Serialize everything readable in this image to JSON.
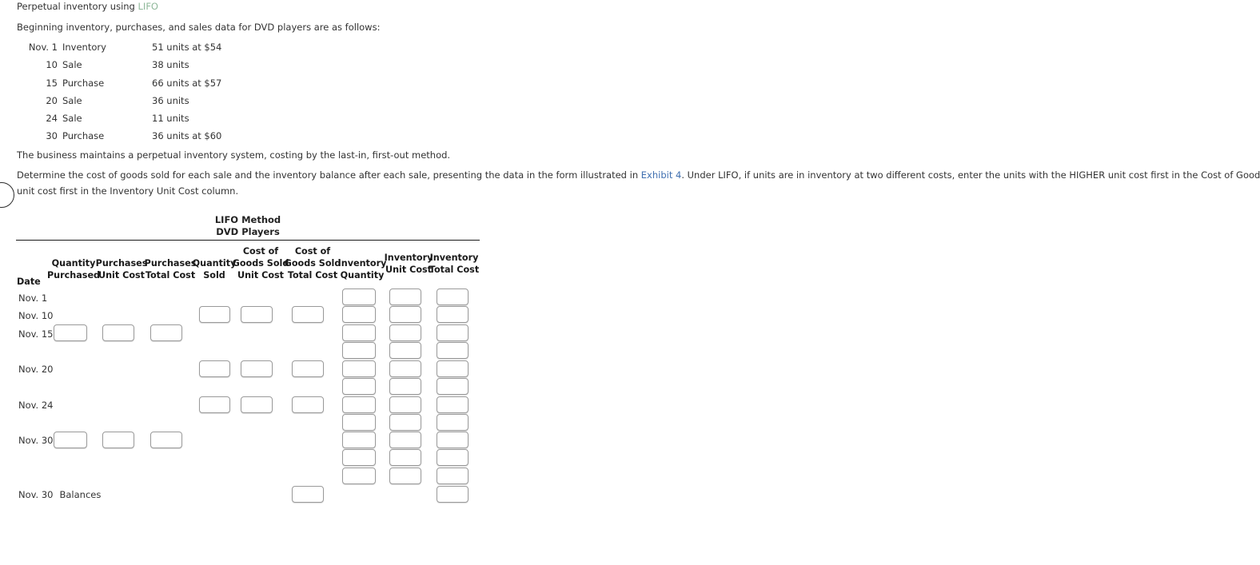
{
  "intro": {
    "title_prefix": "Perpetual inventory using ",
    "title_link": "LIFO",
    "lead": "Beginning inventory, purchases, and sales data for DVD players are as follows:",
    "perpetual_note": "The business maintains a perpetual inventory system, costing by the last-in, first-out method.",
    "determine_part1": "Determine the cost of goods sold for each sale and the inventory balance after each sale, presenting the data in the form illustrated in ",
    "determine_link": "Exhibit 4",
    "determine_part2": ". Under LIFO, if units are in inventory at two different costs, enter the units with the HIGHER unit cost first in the Cost of Goods Sold Unit Cost column and LOWER",
    "determine_line2": "unit cost first in the Inventory Unit Cost column."
  },
  "data_rows": [
    {
      "date": "Nov. 1",
      "label": "Inventory",
      "detail": "51 units at $54"
    },
    {
      "date": "10",
      "label": "Sale",
      "detail": "38 units"
    },
    {
      "date": "15",
      "label": "Purchase",
      "detail": "66 units at $57"
    },
    {
      "date": "20",
      "label": "Sale",
      "detail": "36 units"
    },
    {
      "date": "24",
      "label": "Sale",
      "detail": "11 units"
    },
    {
      "date": "30",
      "label": "Purchase",
      "detail": "36 units at $60"
    }
  ],
  "table": {
    "title_line1": "LIFO Method",
    "title_line2": "DVD Players",
    "headers": {
      "date": "Date",
      "qty_purchased_l1": "Quantity",
      "qty_purchased_l2": "Purchased",
      "purch_unit_l1": "Purchases",
      "purch_unit_l2": "Unit Cost",
      "purch_total_l1": "Purchases",
      "purch_total_l2": "Total Cost",
      "qty_sold_l1": "Quantity",
      "qty_sold_l2": "Sold",
      "cogs_unit_l1": "Cost of",
      "cogs_unit_l2": "Goods Sold",
      "cogs_unit_l3": "Unit Cost",
      "cogs_total_l1": "Cost of",
      "cogs_total_l2": "Goods Sold",
      "cogs_total_l3": "Total Cost",
      "inv_qty_l1": "Inventory",
      "inv_qty_l2": "Quantity",
      "inv_unit_l1": "Inventory",
      "inv_unit_l2": "Unit Cost",
      "inv_total_l1": "Inventory",
      "inv_total_l2": "Total Cost"
    },
    "row_labels": [
      {
        "date": "Nov. 1",
        "extra": ""
      },
      {
        "date": "Nov. 10",
        "extra": ""
      },
      {
        "date": "Nov. 15",
        "extra": ""
      },
      {
        "date": "Nov. 20",
        "extra": ""
      },
      {
        "date": "Nov. 24",
        "extra": ""
      },
      {
        "date": "Nov. 30",
        "extra": ""
      },
      {
        "date": "Nov. 30",
        "extra": "Balances"
      }
    ],
    "input_value": ""
  }
}
